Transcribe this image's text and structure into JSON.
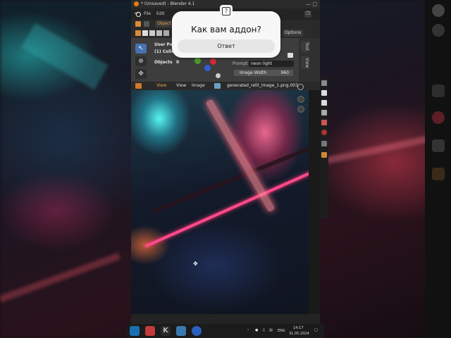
{
  "window": {
    "title": "* (Unsaved) - Blender 4.1"
  },
  "menu": {
    "file": "File",
    "edit": "Edit"
  },
  "toolbar": {
    "mode": "Object",
    "options": "Options"
  },
  "viewport": {
    "user_perspective": "User Per",
    "collection": "(1) Colle",
    "objects_label": "Objects",
    "objects_count": "0"
  },
  "side_tabs": [
    "Tool",
    "View"
  ],
  "properties": {
    "prompt_label": "Prompt",
    "prompt_value": "neon light",
    "image_width_label": "Image Width",
    "image_width_value": "960"
  },
  "image_editor": {
    "view": "View",
    "view2": "View",
    "image": "Image",
    "filename": "generated_relit_image_1.png.003"
  },
  "popup": {
    "question": "Как вам аддон?",
    "answer_button": "Ответ"
  },
  "taskbar": {
    "language": "ENG",
    "time": "14:17",
    "date": "31.05.2024"
  }
}
